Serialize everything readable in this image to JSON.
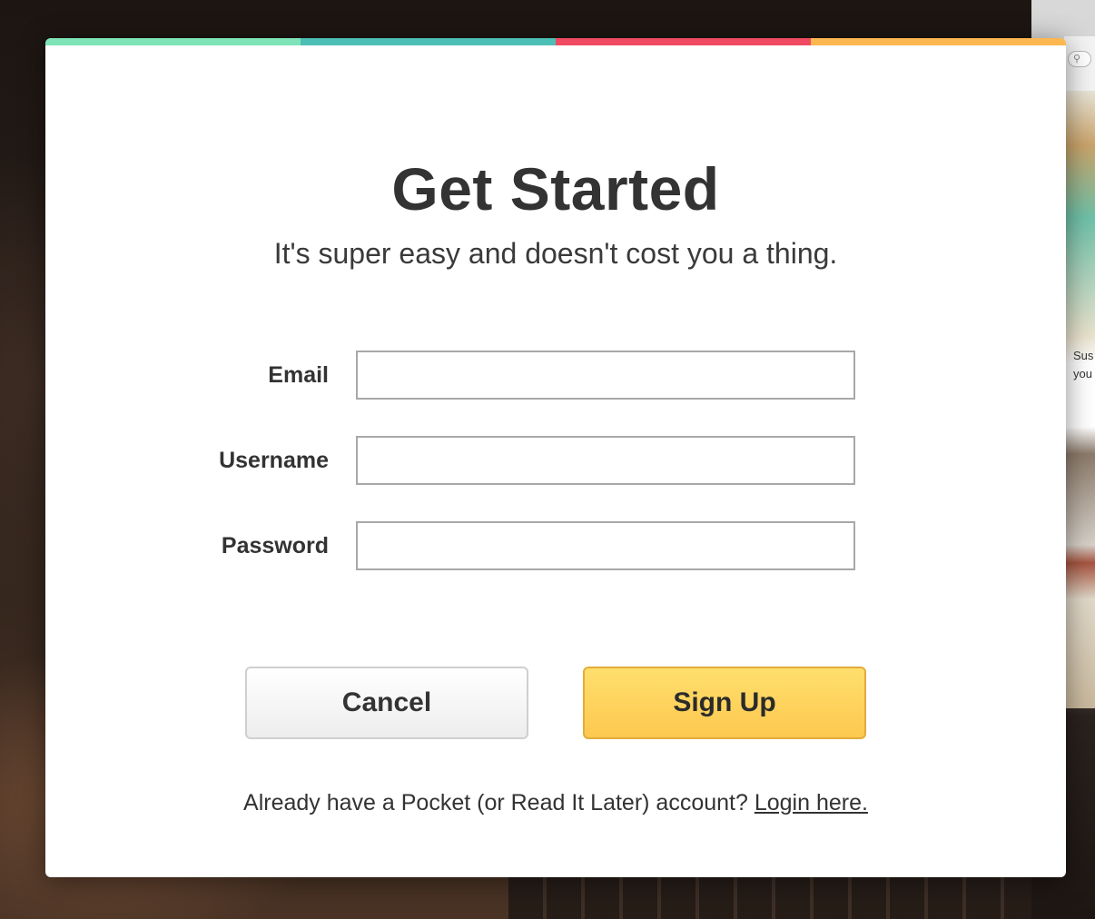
{
  "modal": {
    "color_bar": [
      "#7ee4b8",
      "#4bbfb6",
      "#ef4a62",
      "#fcb750"
    ],
    "title": "Get Started",
    "subtitle": "It's super easy and doesn't cost you a thing.",
    "fields": {
      "email": {
        "label": "Email",
        "value": "",
        "placeholder": ""
      },
      "username": {
        "label": "Username",
        "value": "",
        "placeholder": ""
      },
      "password": {
        "label": "Password",
        "value": "",
        "placeholder": ""
      }
    },
    "buttons": {
      "cancel_label": "Cancel",
      "signup_label": "Sign Up"
    },
    "footer": {
      "prompt": "Already have a Pocket (or Read It Later) account?",
      "login_link": "Login here."
    }
  },
  "background": {
    "search_icon": "search-icon",
    "peek_text_1": "Sus",
    "peek_text_2": "you"
  }
}
